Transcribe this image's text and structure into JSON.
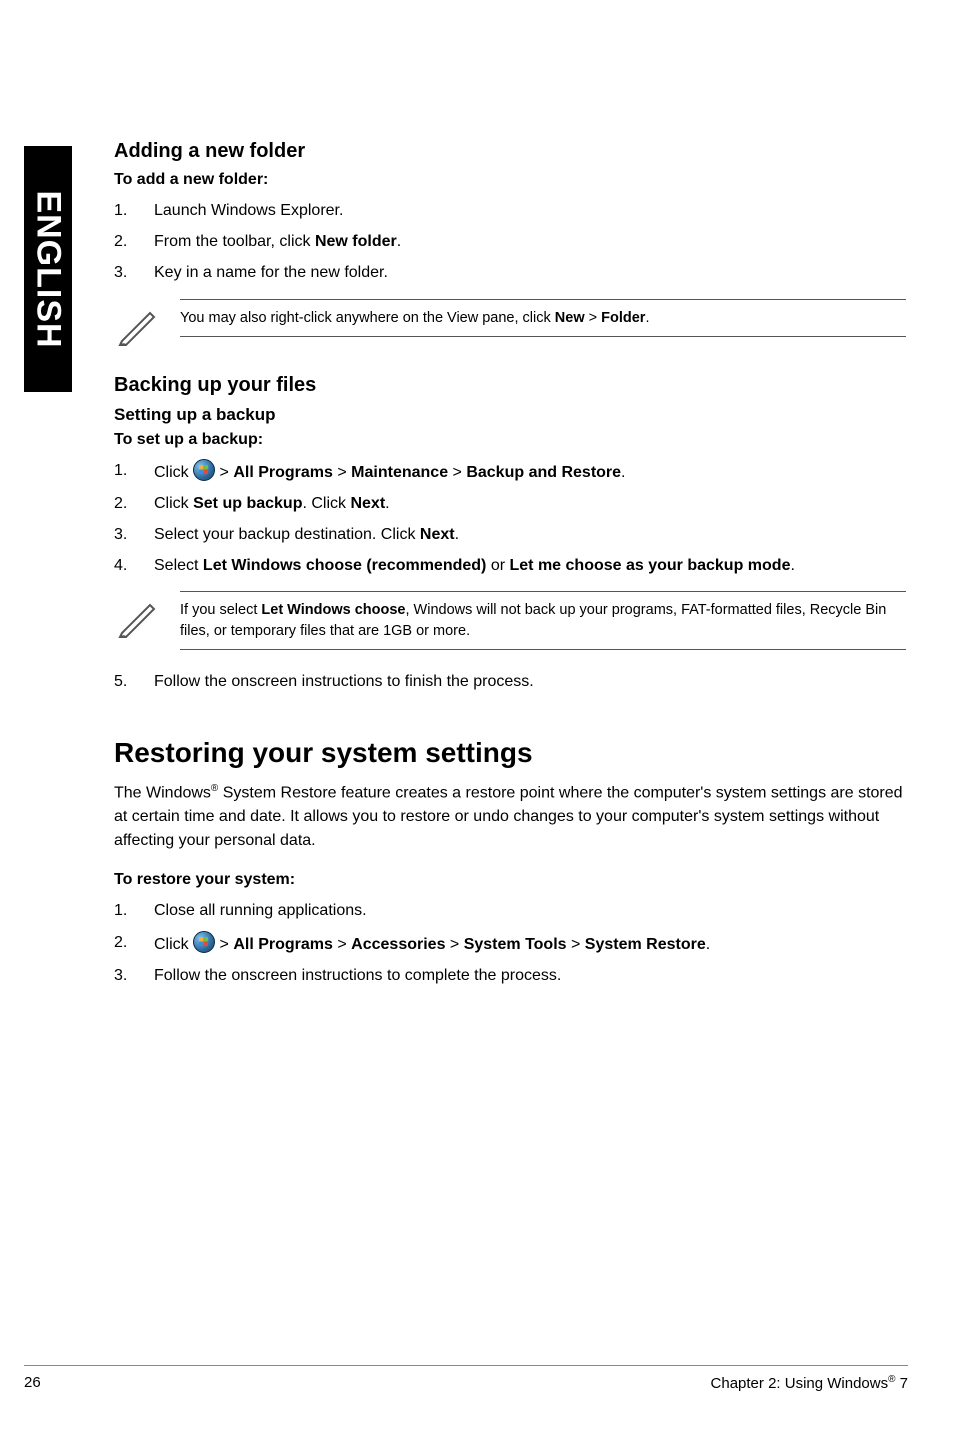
{
  "side_tab": "ENGLISH",
  "adding": {
    "title": "Adding a new folder",
    "sub": "To add a new folder:",
    "steps": {
      "n1": "1.",
      "t1": "Launch Windows Explorer.",
      "n2": "2.",
      "t2_pre": "From the toolbar, click ",
      "t2_b": "New folder",
      "t2_post": ".",
      "n3": "3.",
      "t3": "Key in a name for the new folder."
    },
    "note_pre": "You may also right-click anywhere on the View pane, click ",
    "note_b1": "New",
    "note_mid": " > ",
    "note_b2": "Folder",
    "note_post": "."
  },
  "backing": {
    "title": "Backing up your files",
    "sub1": "Setting up a backup",
    "sub2": "To set up a backup:",
    "s1_n": "1.",
    "s1_pre": "Click ",
    "s1_gt1": " > ",
    "s1_b1": "All Programs",
    "s1_gt2": " > ",
    "s1_b2": "Maintenance",
    "s1_gt3": " > ",
    "s1_b3": "Backup and Restore",
    "s1_post": ".",
    "s2_n": "2.",
    "s2_pre": "Click ",
    "s2_b1": "Set up backup",
    "s2_mid": ". Click ",
    "s2_b2": "Next",
    "s2_post": ".",
    "s3_n": "3.",
    "s3_pre": "Select your backup destination. Click ",
    "s3_b": "Next",
    "s3_post": ".",
    "s4_n": "4.",
    "s4_pre": "Select ",
    "s4_b1": "Let Windows choose (recommended)",
    "s4_mid": " or ",
    "s4_b2": "Let me choose as your backup mode",
    "s4_post": ".",
    "note_pre": "If you select ",
    "note_b": "Let Windows choose",
    "note_post": ", Windows will not back up your programs, FAT-formatted files, Recycle Bin files, or temporary files that are 1GB or more.",
    "s5_n": "5.",
    "s5_t": "Follow the onscreen instructions to finish the process."
  },
  "restoring": {
    "title": "Restoring your system settings",
    "para_pre": "The Windows",
    "para_sup": "®",
    "para_post": " System Restore feature creates a restore point where the computer's system settings are stored at certain time and date. It allows you to restore or undo changes to your computer's system settings without affecting your personal data.",
    "sub": "To restore your system:",
    "s1_n": "1.",
    "s1_t": "Close all running applications.",
    "s2_n": "2.",
    "s2_pre": "Click ",
    "s2_gt1": " > ",
    "s2_b1": "All Programs",
    "s2_gt2": " > ",
    "s2_b2": "Accessories",
    "s2_gt3": " > ",
    "s2_b3": "System Tools",
    "s2_gt4": " > ",
    "s2_b4": "System Restore",
    "s2_post": ".",
    "s3_n": "3.",
    "s3_t": "Follow the onscreen instructions to complete the process."
  },
  "footer": {
    "page": "26",
    "chapter_pre": "Chapter 2: Using Windows",
    "chapter_sup": "®",
    "chapter_post": " 7"
  }
}
